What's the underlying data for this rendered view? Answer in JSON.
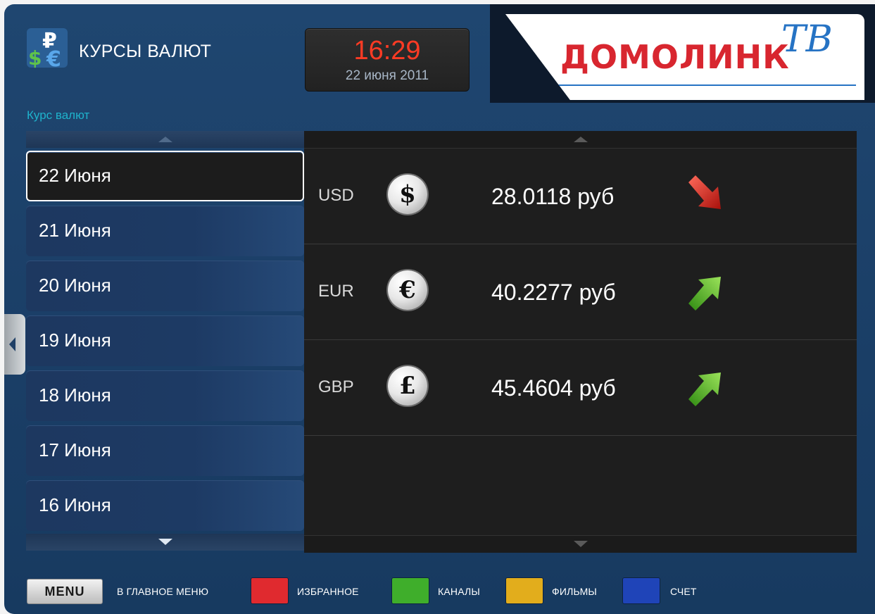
{
  "header": {
    "app_title": "КУРСЫ ВАЛЮТ",
    "app_icon": "currency-ruble-dollar-euro-icon",
    "clock_time": "16:29",
    "clock_date": "22 июня 2011",
    "logo_text": "ДОМОЛИНК",
    "logo_tv": "ТВ"
  },
  "section_label": "Курс валют",
  "dates": [
    {
      "label": "22 Июня",
      "selected": true
    },
    {
      "label": "21 Июня",
      "selected": false
    },
    {
      "label": "20 Июня",
      "selected": false
    },
    {
      "label": "19 Июня",
      "selected": false
    },
    {
      "label": "18 Июня",
      "selected": false
    },
    {
      "label": "17 Июня",
      "selected": false
    },
    {
      "label": "16 Июня",
      "selected": false
    }
  ],
  "rates": [
    {
      "code": "USD",
      "symbol": "$",
      "value": "28.0118 руб",
      "trend": "down",
      "icon": "dollar-coin-icon",
      "trend_icon": "red-arrow-down-icon"
    },
    {
      "code": "EUR",
      "symbol": "€",
      "value": "40.2277 руб",
      "trend": "up",
      "icon": "euro-coin-icon",
      "trend_icon": "green-arrow-up-icon"
    },
    {
      "code": "GBP",
      "symbol": "£",
      "value": "45.4604 руб",
      "trend": "up",
      "icon": "pound-coin-icon",
      "trend_icon": "green-arrow-up-icon"
    }
  ],
  "footer": {
    "menu_label": "MENU",
    "menu_caption": "В ГЛАВНОЕ МЕНЮ",
    "keys": [
      {
        "color": "#e02a2f",
        "label": "ИЗБРАННОЕ"
      },
      {
        "color": "#3fae2b",
        "label": "КАНАЛЫ"
      },
      {
        "color": "#e2ad1c",
        "label": "ФИЛЬМЫ"
      },
      {
        "color": "#1f44b8",
        "label": "СЧЕТ"
      }
    ]
  },
  "colors": {
    "accent_time": "#ff3b24",
    "section_label": "#1fb3cc",
    "logo_red": "#d8262f",
    "logo_blue": "#2673c4"
  }
}
